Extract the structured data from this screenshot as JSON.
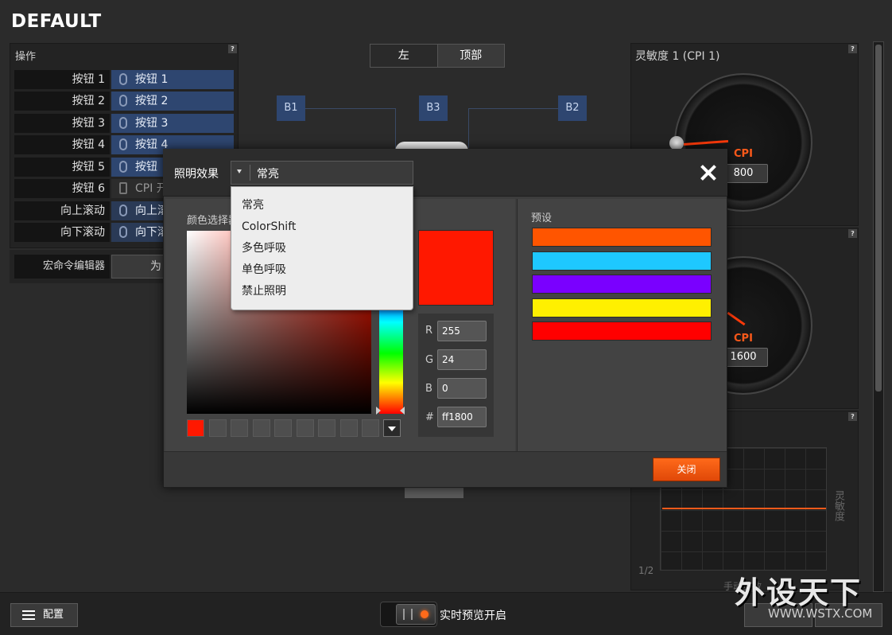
{
  "header": {
    "title": "DEFAULT"
  },
  "actions": {
    "title": "操作",
    "rows": [
      {
        "label": "按钮 1",
        "value": "按钮 1"
      },
      {
        "label": "按钮 2",
        "value": "按钮 2"
      },
      {
        "label": "按钮 3",
        "value": "按钮 3"
      },
      {
        "label": "按钮 4",
        "value": "按钮 4"
      },
      {
        "label": "按钮 5",
        "value": "按钮"
      },
      {
        "label": "按钮 6",
        "value": "CPI 开"
      },
      {
        "label": "向上滚动",
        "value": "向上滚"
      },
      {
        "label": "向下滚动",
        "value": "向下滚"
      }
    ],
    "macro_label": "宏命令编辑器",
    "macro_button": "为"
  },
  "view_tabs": {
    "left": "左",
    "top": "顶部"
  },
  "mouse_tags": {
    "b1": "B1",
    "b2": "B2",
    "b3": "B3"
  },
  "sensitivity": {
    "title": "灵敏度 1 (CPI 1)",
    "gauge1": {
      "label": "CPI",
      "value": "800"
    },
    "gauge2": {
      "label": "CPI",
      "value": "1600"
    },
    "chart_axis": "灵敏度",
    "page": "1/2"
  },
  "lighting_dialog": {
    "effect_label": "照明效果",
    "effect_value": "常亮",
    "effect_options": [
      "常亮",
      "ColorShift",
      "多色呼吸",
      "单色呼吸",
      "禁止照明"
    ],
    "color_picker_label": "颜色选择器",
    "preset_label": "预设",
    "current_color": "#ff1800",
    "rgb": {
      "r_label": "R",
      "r": "255",
      "g_label": "G",
      "g": "24",
      "b_label": "B",
      "b": "0",
      "hex_label": "#",
      "hex": "ff1800"
    },
    "presets": [
      "#ff5500",
      "#1ec8ff",
      "#7a00ff",
      "#fff000",
      "#ff0000"
    ],
    "close_button": "关闭"
  },
  "bottom": {
    "config_button": "配置",
    "live_preview": "实时预览开启"
  },
  "watermark": {
    "brand": "外设天下",
    "url": "WWW.WSTX.COM",
    "faint": "手动灵敏"
  }
}
